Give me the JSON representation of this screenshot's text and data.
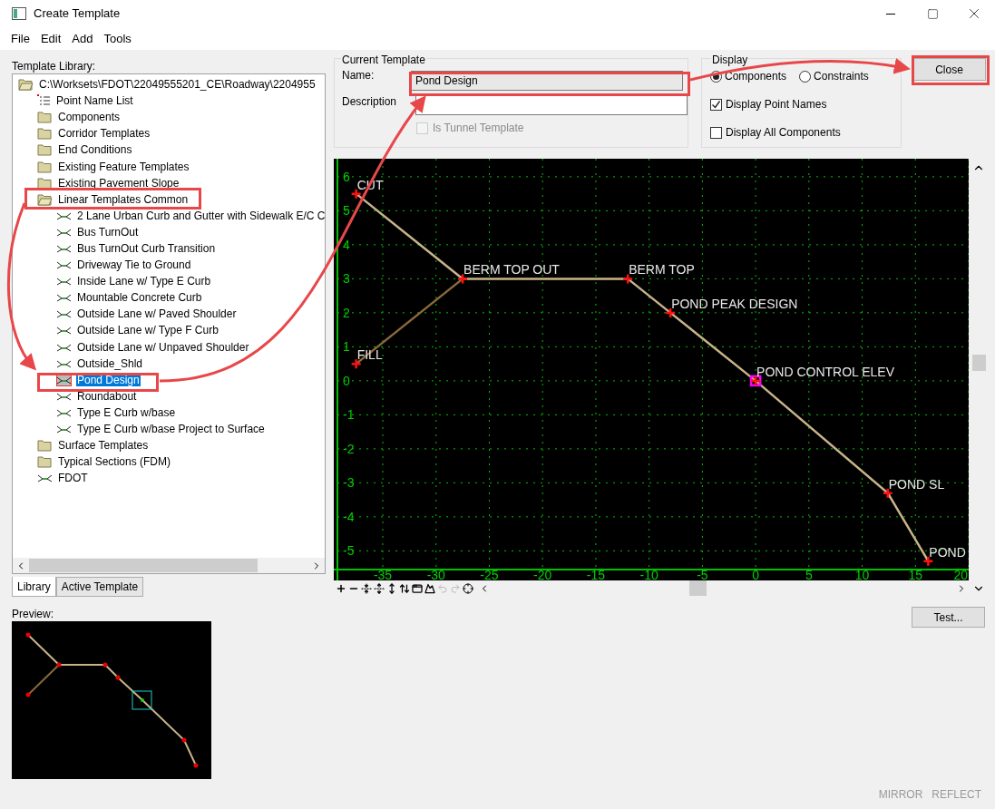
{
  "window": {
    "title": "Create Template"
  },
  "menu": [
    "File",
    "Edit",
    "Add",
    "Tools"
  ],
  "library": {
    "label": "Template Library:",
    "tree": [
      {
        "label": "C:\\Worksets\\FDOT\\22049555201_CE\\Roadway\\2204955",
        "kind": "folder",
        "expanded": true,
        "selected": false,
        "children": [
          {
            "label": "Point Name List",
            "kind": "list",
            "selected": false
          },
          {
            "label": "Components",
            "kind": "folder",
            "expanded": false,
            "selected": false
          },
          {
            "label": "Corridor Templates",
            "kind": "folder",
            "expanded": false,
            "selected": false
          },
          {
            "label": "End Conditions",
            "kind": "folder",
            "expanded": false,
            "selected": false
          },
          {
            "label": "Existing Feature Templates",
            "kind": "folder",
            "expanded": false,
            "selected": false
          },
          {
            "label": "Existing Pavement Slope",
            "kind": "folder",
            "expanded": false,
            "selected": false
          },
          {
            "label": "Linear Templates Common",
            "kind": "folder",
            "expanded": true,
            "selected": false,
            "children": [
              {
                "label": "2 Lane Urban Curb and Gutter with Sidewalk E/C C",
                "kind": "template",
                "selected": false
              },
              {
                "label": "Bus TurnOut",
                "kind": "template",
                "selected": false
              },
              {
                "label": "Bus TurnOut Curb Transition",
                "kind": "template",
                "selected": false
              },
              {
                "label": "Driveway Tie to Ground",
                "kind": "template",
                "selected": false
              },
              {
                "label": "Inside Lane w/ Type E Curb",
                "kind": "template",
                "selected": false
              },
              {
                "label": "Mountable Concrete Curb",
                "kind": "template",
                "selected": false
              },
              {
                "label": "Outside Lane w/ Paved Shoulder",
                "kind": "template",
                "selected": false
              },
              {
                "label": "Outside Lane w/ Type F Curb",
                "kind": "template",
                "selected": false
              },
              {
                "label": "Outside Lane w/ Unpaved Shoulder",
                "kind": "template",
                "selected": false
              },
              {
                "label": "Outside_Shld",
                "kind": "template",
                "selected": false
              },
              {
                "label": "Pond Design",
                "kind": "template",
                "selected": true
              },
              {
                "label": "Roundabout",
                "kind": "template",
                "selected": false
              },
              {
                "label": "Type E Curb w/base",
                "kind": "template",
                "selected": false
              },
              {
                "label": "Type E Curb w/base Project to Surface",
                "kind": "template",
                "selected": false
              }
            ]
          },
          {
            "label": "Surface Templates",
            "kind": "folder",
            "expanded": false,
            "selected": false
          },
          {
            "label": "Typical Sections (FDM)",
            "kind": "folder",
            "expanded": false,
            "selected": false
          },
          {
            "label": "FDOT",
            "kind": "template",
            "selected": false
          }
        ]
      }
    ]
  },
  "tabs": [
    {
      "label": "Library",
      "selected": true
    },
    {
      "label": "Active Template",
      "selected": false
    }
  ],
  "preview_label": "Preview:",
  "current_template": {
    "title": "Current Template",
    "name_label": "Name:",
    "name": "Pond Design",
    "description_label": "Description",
    "tunnel": {
      "label": "Is Tunnel Template",
      "checked": false,
      "disabled": true
    }
  },
  "display": {
    "title": "Display",
    "modes": [
      {
        "label": "Components",
        "selected": true
      },
      {
        "label": "Constraints",
        "selected": false
      }
    ],
    "options": [
      {
        "label": "Display Point Names",
        "checked": true
      },
      {
        "label": "Display All Components",
        "checked": false
      }
    ]
  },
  "close_button": "Close",
  "test_button": "Test...",
  "footer": [
    "MIRROR",
    "REFLECT"
  ],
  "view": {
    "chart_data": {
      "type": "line",
      "grid": true,
      "x": [
        -37.5,
        -27.5,
        -12,
        -8,
        0,
        12.4,
        16.2
      ],
      "series": [
        {
          "color": "#c9b48a",
          "marker": "cross",
          "values": [
            5.5,
            3,
            3,
            2,
            0,
            -3.3,
            -5.3
          ]
        },
        {
          "color": "#8b6a3c",
          "marker": "cross",
          "values": [
            0.5,
            3,
            null,
            null,
            null,
            null,
            null
          ]
        }
      ],
      "xlim": [
        -39.6,
        20
      ],
      "ylim": [
        -5.87,
        6.53
      ],
      "xticks": [
        -35,
        -30,
        -25,
        -20,
        -15,
        -10,
        -5,
        0,
        5,
        10,
        15,
        20
      ],
      "yticks": [
        6,
        5,
        4,
        3,
        2,
        1,
        0,
        -1,
        -2,
        -3,
        -4,
        -5
      ],
      "annotations": [
        {
          "x": -37.5,
          "y": 5.5,
          "text": "CUT"
        },
        {
          "x": -27.5,
          "y": 3,
          "text": "BERM TOP OUT"
        },
        {
          "x": -12,
          "y": 3,
          "text": "BERM TOP"
        },
        {
          "x": -8,
          "y": 2,
          "text": "POND PEAK DESIGN"
        },
        {
          "x": 0,
          "y": 0,
          "text": "POND CONTROL ELEV"
        },
        {
          "x": 12.4,
          "y": -3.3,
          "text": "POND SL"
        },
        {
          "x": 16.2,
          "y": -5.3,
          "text": "POND"
        },
        {
          "x": -37.5,
          "y": 0.5,
          "text": "FILL"
        }
      ]
    }
  }
}
